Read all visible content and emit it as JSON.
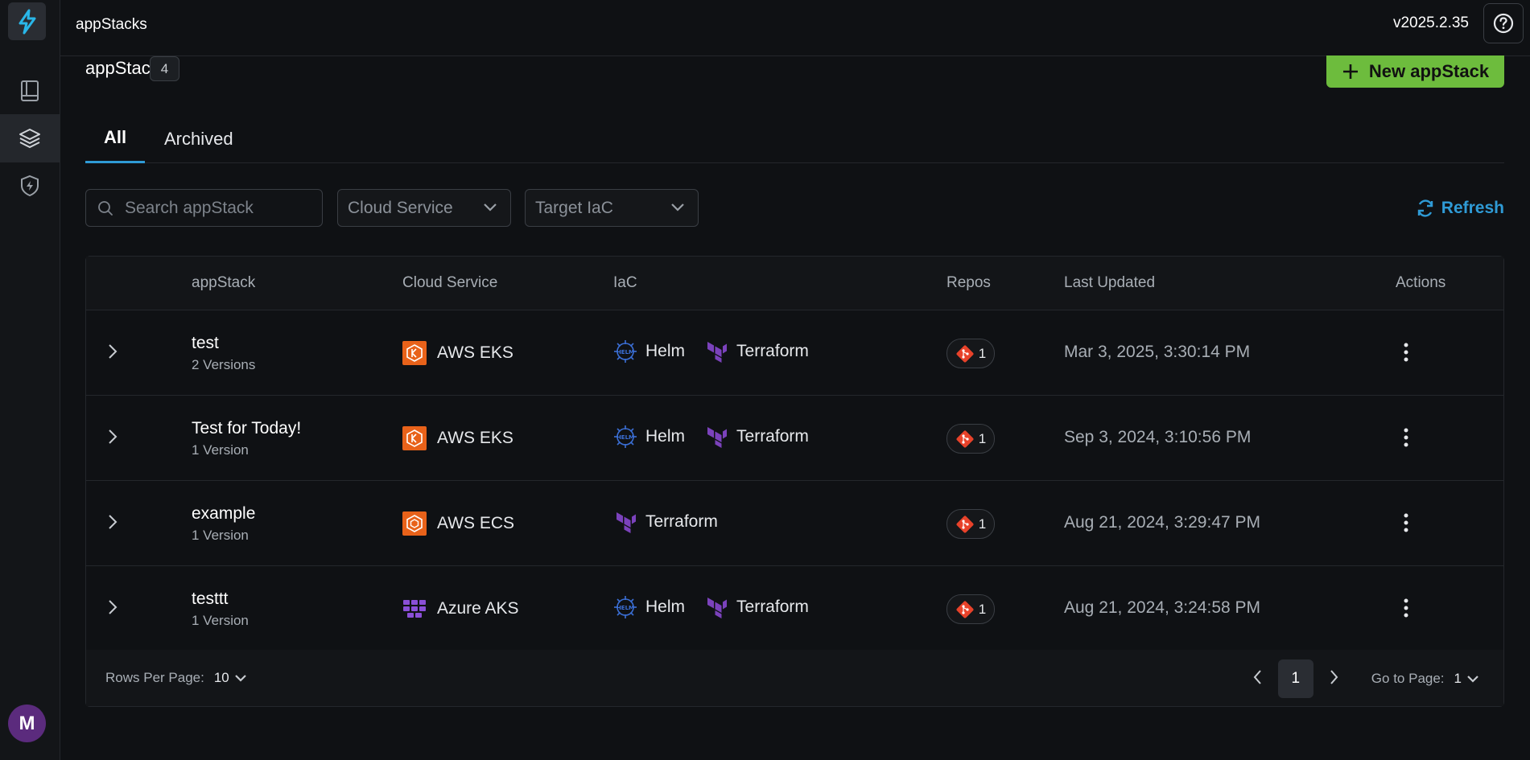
{
  "topbar": {
    "app_title": "appStacks",
    "version": "v2025.2.35"
  },
  "sidebar": {
    "avatar_initial": "M"
  },
  "header": {
    "title": "appStacks",
    "count": "4",
    "new_button": "New appStack"
  },
  "tabs": [
    {
      "label": "All"
    },
    {
      "label": "Archived"
    }
  ],
  "filters": {
    "search_placeholder": "Search appStack",
    "cloud_service": "Cloud Service",
    "target_iac": "Target IaC",
    "refresh": "Refresh"
  },
  "table": {
    "columns": [
      "appStack",
      "Cloud Service",
      "IaC",
      "Repos",
      "Last Updated",
      "Actions"
    ],
    "rows": [
      {
        "name": "test",
        "versions": "2 Versions",
        "cloud": "AWS EKS",
        "iac_helm": "Helm",
        "iac_tf": "Terraform",
        "repos": "1",
        "updated": "Mar 3, 2025, 3:30:14 PM"
      },
      {
        "name": "Test for Today!",
        "versions": "1 Version",
        "cloud": "AWS EKS",
        "iac_helm": "Helm",
        "iac_tf": "Terraform",
        "repos": "1",
        "updated": "Sep 3, 2024, 3:10:56 PM"
      },
      {
        "name": "example",
        "versions": "1 Version",
        "cloud": "AWS ECS",
        "iac_tf": "Terraform",
        "repos": "1",
        "updated": "Aug 21, 2024, 3:29:47 PM"
      },
      {
        "name": "testtt",
        "versions": "1 Version",
        "cloud": "Azure AKS",
        "iac_helm": "Helm",
        "iac_tf": "Terraform",
        "repos": "1",
        "updated": "Aug 21, 2024, 3:24:58 PM"
      }
    ]
  },
  "footer": {
    "rows_per_page_label": "Rows Per Page:",
    "rows_per_page": "10",
    "current_page": "1",
    "goto_label": "Go to Page:",
    "goto_value": "1"
  },
  "colors": {
    "accent": "#2f9bd6",
    "primary_button": "#6dbc3d",
    "aws": "#e8621a",
    "azure": "#8a4fd6",
    "terraform": "#7b42bc",
    "git": "#e8422a"
  }
}
